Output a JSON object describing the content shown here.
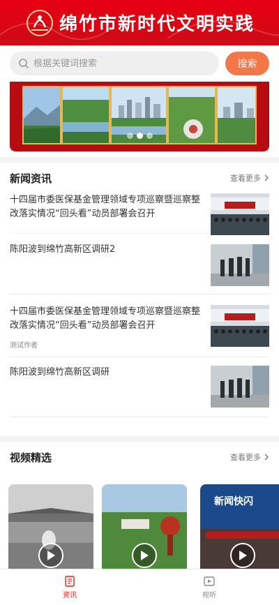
{
  "header": {
    "title": "绵竹市新时代文明实践"
  },
  "search": {
    "placeholder": "根据关键词搜索",
    "button_label": "搜索"
  },
  "banner": {
    "slide_count": 3,
    "active_index": 1
  },
  "news": {
    "section_title": "新闻资讯",
    "more_label": "查看更多",
    "items": [
      {
        "title": "十四届市委医保基金管理领域专项巡察暨巡察整改落实情况“回头看”动员部署会召开",
        "author": ""
      },
      {
        "title": "陈阳波到绵竹高新区调研2",
        "author": ""
      },
      {
        "title": "十四届市委医保基金管理领域专项巡察暨巡察整改落实情况“回头看”动员部署会召开",
        "author": "测试作者"
      },
      {
        "title": "陈阳波到绵竹高新区调研",
        "author": ""
      }
    ]
  },
  "video": {
    "section_title": "视频精选",
    "more_label": "查看更多",
    "card3_caption": "新闻快闪"
  },
  "tabbar": {
    "items": [
      {
        "label": "资讯",
        "icon": "news-icon",
        "active": true
      },
      {
        "label": "视听",
        "icon": "video-icon",
        "active": false
      }
    ]
  },
  "colors": {
    "brand_red": "#e60012",
    "search_button": "#f4774a",
    "active_tab": "#d9261c"
  }
}
